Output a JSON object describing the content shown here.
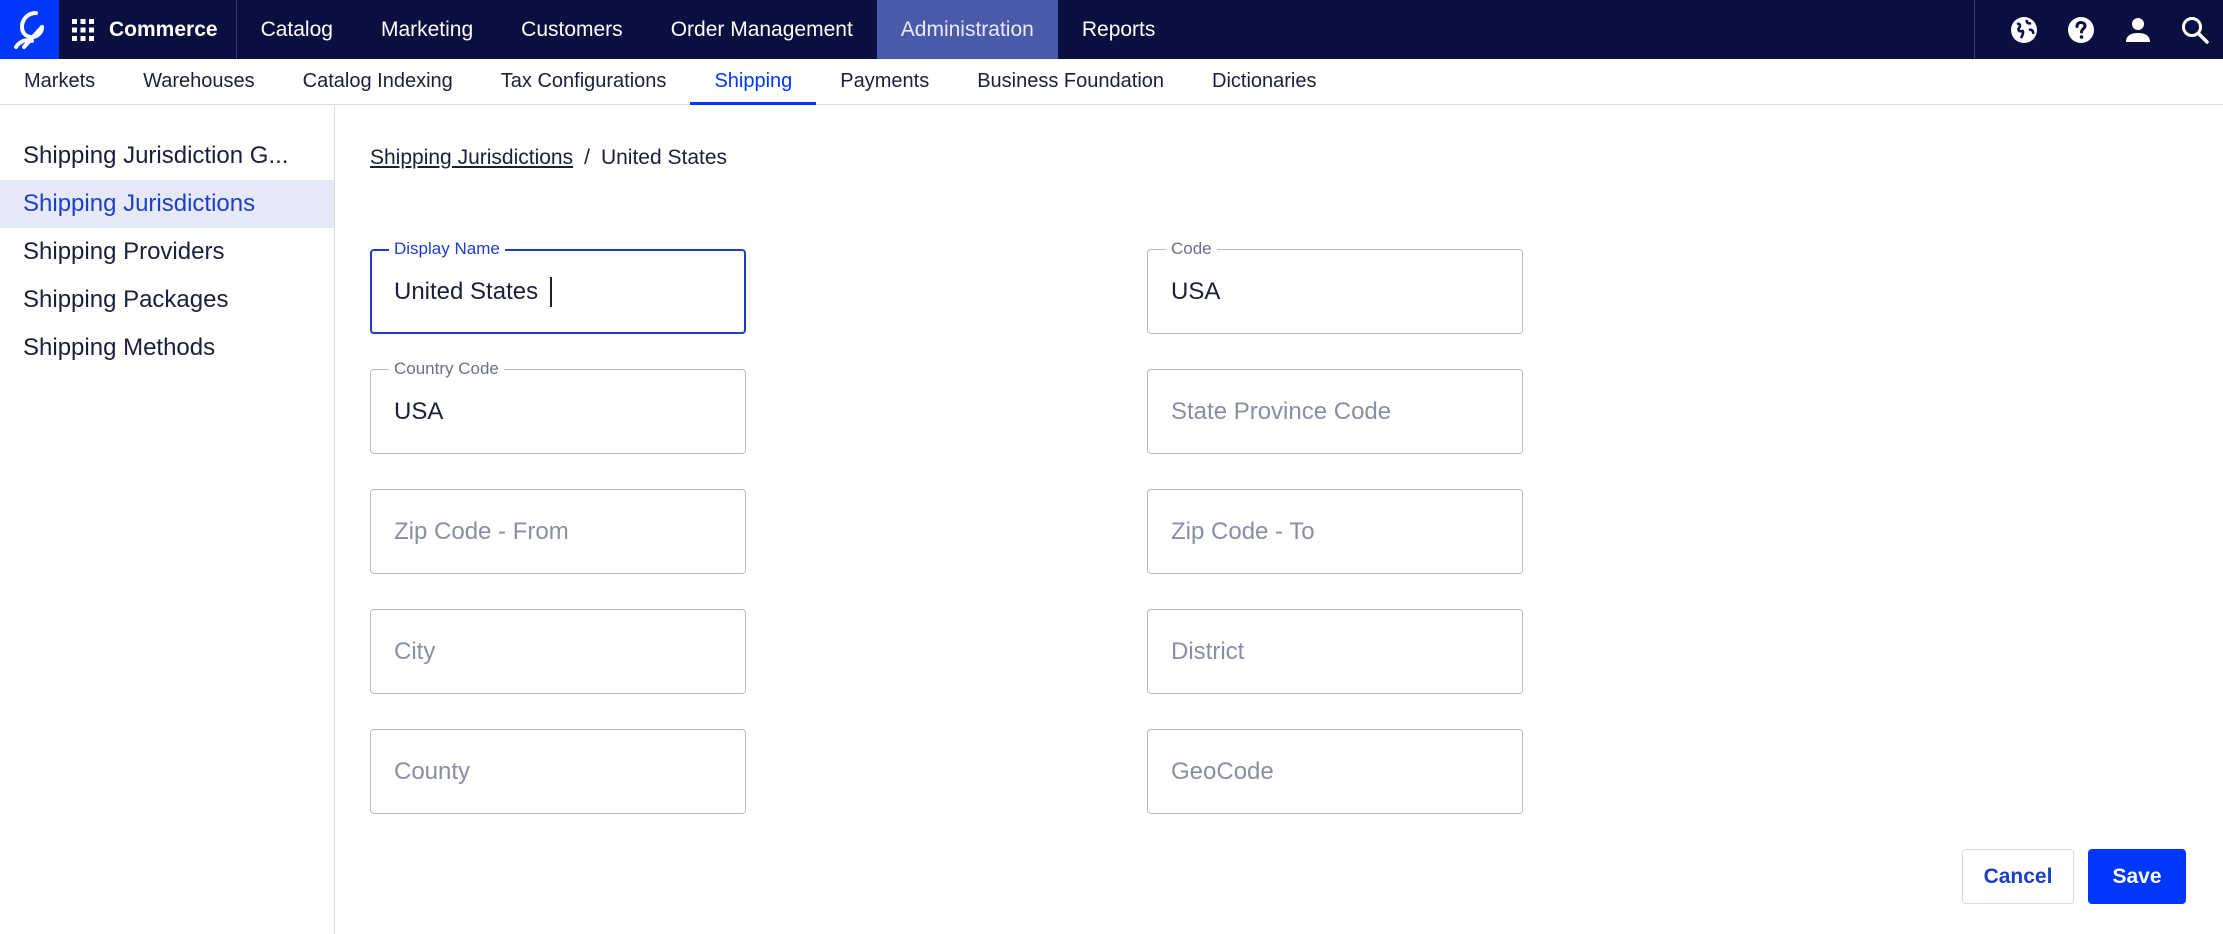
{
  "header": {
    "product": "Commerce",
    "nav": [
      {
        "label": "Catalog",
        "active": false
      },
      {
        "label": "Marketing",
        "active": false
      },
      {
        "label": "Customers",
        "active": false
      },
      {
        "label": "Order Management",
        "active": false
      },
      {
        "label": "Administration",
        "active": true
      },
      {
        "label": "Reports",
        "active": false
      }
    ],
    "icons": [
      "globe-icon",
      "help-icon",
      "user-icon",
      "search-icon"
    ]
  },
  "subnav": {
    "items": [
      {
        "label": "Markets",
        "active": false
      },
      {
        "label": "Warehouses",
        "active": false
      },
      {
        "label": "Catalog Indexing",
        "active": false
      },
      {
        "label": "Tax Configurations",
        "active": false
      },
      {
        "label": "Shipping",
        "active": true
      },
      {
        "label": "Payments",
        "active": false
      },
      {
        "label": "Business Foundation",
        "active": false
      },
      {
        "label": "Dictionaries",
        "active": false
      }
    ]
  },
  "sidebar": {
    "items": [
      {
        "label": "Shipping Jurisdiction G...",
        "active": false
      },
      {
        "label": "Shipping Jurisdictions",
        "active": true
      },
      {
        "label": "Shipping Providers",
        "active": false
      },
      {
        "label": "Shipping Packages",
        "active": false
      },
      {
        "label": "Shipping Methods",
        "active": false
      }
    ]
  },
  "breadcrumb": {
    "parent": "Shipping Jurisdictions",
    "separator": "/",
    "current": "United States"
  },
  "form": {
    "display_name": {
      "label": "Display Name",
      "value": "United States",
      "placeholder": ""
    },
    "code": {
      "label": "Code",
      "value": "USA",
      "placeholder": ""
    },
    "country_code": {
      "label": "Country Code",
      "value": "USA",
      "placeholder": ""
    },
    "state_province_code": {
      "label": "",
      "value": "",
      "placeholder": "State Province Code"
    },
    "zip_from": {
      "label": "",
      "value": "",
      "placeholder": "Zip Code - From"
    },
    "zip_to": {
      "label": "",
      "value": "",
      "placeholder": "Zip Code - To"
    },
    "city": {
      "label": "",
      "value": "",
      "placeholder": "City"
    },
    "district": {
      "label": "",
      "value": "",
      "placeholder": "District"
    },
    "county": {
      "label": "",
      "value": "",
      "placeholder": "County"
    },
    "geocode": {
      "label": "",
      "value": "",
      "placeholder": "GeoCode"
    }
  },
  "actions": {
    "cancel_label": "Cancel",
    "save_label": "Save"
  },
  "colors": {
    "header_bg": "#0b0f3f",
    "brand_blue": "#0037ff",
    "active_nav_bg": "#4b5aa8",
    "focus_blue": "#1d3fc7",
    "sidebar_active_bg": "#e6e9fa"
  }
}
